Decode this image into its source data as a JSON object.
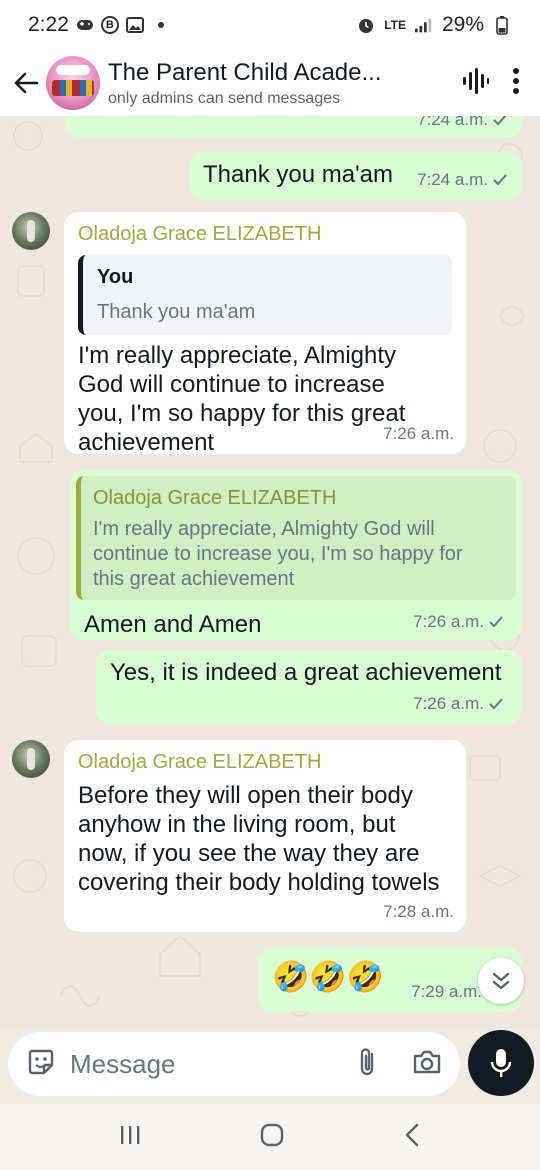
{
  "status_bar": {
    "time": "2:22",
    "network": "LTE",
    "battery": "29%"
  },
  "header": {
    "title": "The Parent Child Acade...",
    "subtitle": "only admins can send messages",
    "avatar_text": "WE SPEAK OUT"
  },
  "messages": {
    "m1": {
      "time": "7:24 a.m."
    },
    "m2": {
      "text": "Thank you ma'am",
      "time": "7:24 a.m."
    },
    "m3": {
      "sender": "Oladoja Grace ELIZABETH",
      "quote_name": "You",
      "quote_text": "Thank you ma'am",
      "lines": [
        "I'm really appreciate, Almighty",
        "God will continue to increase",
        "you, I'm so happy for this great",
        "achievement"
      ],
      "time": "7:26 a.m."
    },
    "m4": {
      "quote_name": "Oladoja Grace ELIZABETH",
      "quote_lines": [
        "I'm really appreciate, Almighty God will",
        "continue to increase you, I'm so happy for",
        "this great achievement"
      ],
      "text": "Amen and Amen",
      "time": "7:26 a.m."
    },
    "m5": {
      "text": "Yes, it is indeed a great achievement",
      "time": "7:26 a.m."
    },
    "m6": {
      "sender": "Oladoja Grace ELIZABETH",
      "lines": [
        "Before they will open their body",
        "anyhow in the living room, but",
        "now, if you see the way they are",
        "covering their body holding towels"
      ],
      "time": "7:28 a.m."
    },
    "m7": {
      "text": "🤣🤣🤣",
      "time": "7:29 a.m."
    }
  },
  "composer": {
    "placeholder": "Message"
  },
  "colors": {
    "outgoing_bubble": "#d9fdd3",
    "incoming_bubble": "#ffffff",
    "sender_name": "#9fa93c",
    "check": "#667781",
    "mic_button": "#111b21"
  }
}
